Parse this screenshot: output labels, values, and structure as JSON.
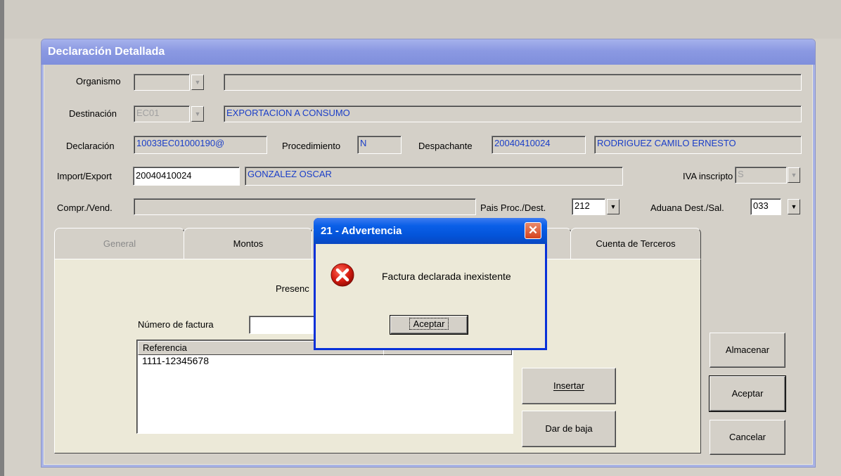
{
  "window": {
    "title": "Declaración Detallada"
  },
  "form": {
    "organismo": {
      "label": "Organismo",
      "code": "",
      "description": ""
    },
    "destinacion": {
      "label": "Destinación",
      "code": "EC01",
      "description": "EXPORTACION A CONSUMO"
    },
    "declaracion": {
      "label": "Declaración",
      "value": "10033EC01000190@"
    },
    "procedimiento": {
      "label": "Procedimiento",
      "value": "N"
    },
    "despachante": {
      "label": "Despachante",
      "id": "20040410024",
      "name": "RODRIGUEZ CAMILO ERNESTO"
    },
    "import_export": {
      "label": "Import/Export",
      "id": "20040410024",
      "name": "GONZALEZ OSCAR"
    },
    "iva_inscripto": {
      "label": "IVA inscripto",
      "value": "S"
    },
    "compr_vend": {
      "label": "Compr./Vend.",
      "value": ""
    },
    "pais": {
      "label": "Pais Proc./Dest.",
      "value": "212"
    },
    "aduana": {
      "label": "Aduana Dest./Sal.",
      "value": "033"
    }
  },
  "tabs": [
    {
      "label": "General"
    },
    {
      "label": "Montos"
    },
    {
      "label": ""
    },
    {
      "label": "Cuenta de Terceros"
    }
  ],
  "panel": {
    "heading_partial": "Presenc",
    "numero_factura_label": "Número de factura",
    "numero_factura_value": "",
    "list": {
      "columns": [
        "Referencia",
        ""
      ],
      "rows": [
        "1111-12345678"
      ]
    },
    "insertar_label": "Insertar",
    "dar_de_baja_label": "Dar de baja"
  },
  "buttons": {
    "almacenar": "Almacenar",
    "aceptar": "Aceptar",
    "cancelar": "Cancelar"
  },
  "dialog": {
    "title": "21 - Advertencia",
    "message": "Factura declarada inexistente",
    "ok_label": "Aceptar",
    "icon": "error-icon"
  }
}
